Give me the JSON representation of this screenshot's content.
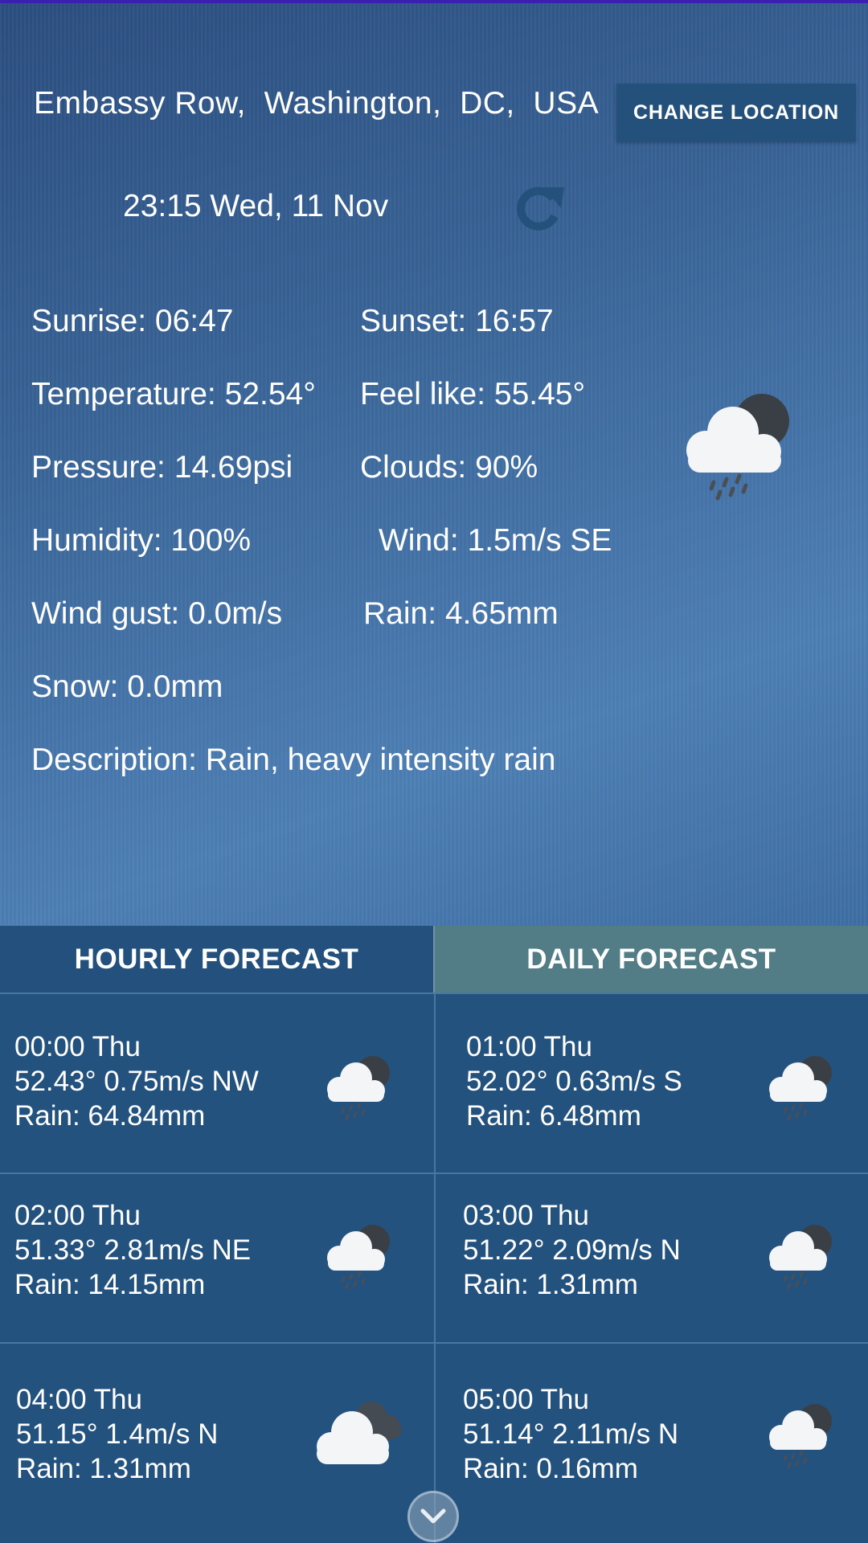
{
  "header": {
    "location": "Embassy Row,  Washington,  DC,  USA",
    "change_location_label": "CHANGE LOCATION",
    "datetime": "23:15 Wed, 11 Nov"
  },
  "current": {
    "sunrise": "Sunrise: 06:47",
    "sunset": "Sunset: 16:57",
    "temperature": "Temperature: 52.54°",
    "feel_like": "Feel like: 55.45°",
    "pressure": "Pressure: 14.69psi",
    "clouds": "Clouds: 90%",
    "humidity": "Humidity: 100%",
    "wind": "Wind: 1.5m/s SE",
    "wind_gust": "Wind gust: 0.0m/s",
    "rain": "Rain: 4.65mm",
    "snow": "Snow: 0.0mm",
    "description": "Description: Rain, heavy intensity rain",
    "icon": "rain-cloud-night-icon"
  },
  "tabs": {
    "hourly": "HOURLY FORECAST",
    "daily": "DAILY FORECAST"
  },
  "forecast": [
    {
      "time": "00:00 Thu",
      "temp_wind": "52.43° 0.75m/s NW",
      "rain": "Rain: 64.84mm",
      "icon": "rain-cloud-icon"
    },
    {
      "time": "01:00 Thu",
      "temp_wind": "52.02° 0.63m/s S",
      "rain": "Rain: 6.48mm",
      "icon": "rain-cloud-icon"
    },
    {
      "time": "02:00 Thu",
      "temp_wind": "51.33° 2.81m/s NE",
      "rain": "Rain: 14.15mm",
      "icon": "rain-cloud-icon"
    },
    {
      "time": "03:00 Thu",
      "temp_wind": "51.22° 2.09m/s N",
      "rain": "Rain: 1.31mm",
      "icon": "rain-cloud-icon"
    },
    {
      "time": "04:00 Thu",
      "temp_wind": "51.15° 1.4m/s N",
      "rain": "Rain: 1.31mm",
      "icon": "cloudy-icon"
    },
    {
      "time": "05:00 Thu",
      "temp_wind": "51.14° 2.11m/s N",
      "rain": "Rain: 0.16mm",
      "icon": "rain-cloud-icon"
    }
  ],
  "colors": {
    "accent_button": "#24507c",
    "tab_active": "#23507c",
    "tab_inactive": "#527d86"
  }
}
